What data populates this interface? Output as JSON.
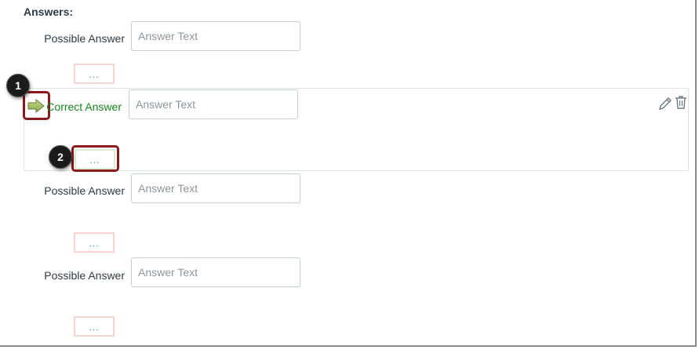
{
  "answers_heading": "Answers:",
  "answers": [
    {
      "label": "Possible Answer",
      "placeholder": "Answer Text",
      "comment": "...",
      "correct": false
    },
    {
      "label": "Correct Answer",
      "placeholder": "Answer Text",
      "comment": "...",
      "correct": true
    },
    {
      "label": "Possible Answer",
      "placeholder": "Answer Text",
      "comment": "...",
      "correct": false
    },
    {
      "label": "Possible Answer",
      "placeholder": "Answer Text",
      "comment": "...",
      "correct": false
    }
  ],
  "callouts": [
    "1",
    "2"
  ],
  "icons": {
    "correct_marker": "green-arrow-icon",
    "edit": "pencil-icon",
    "delete": "trash-icon"
  },
  "colors": {
    "correct_text": "#14891b",
    "callout_border": "#8b1a1a",
    "comment_link": "#3b8fd8"
  }
}
